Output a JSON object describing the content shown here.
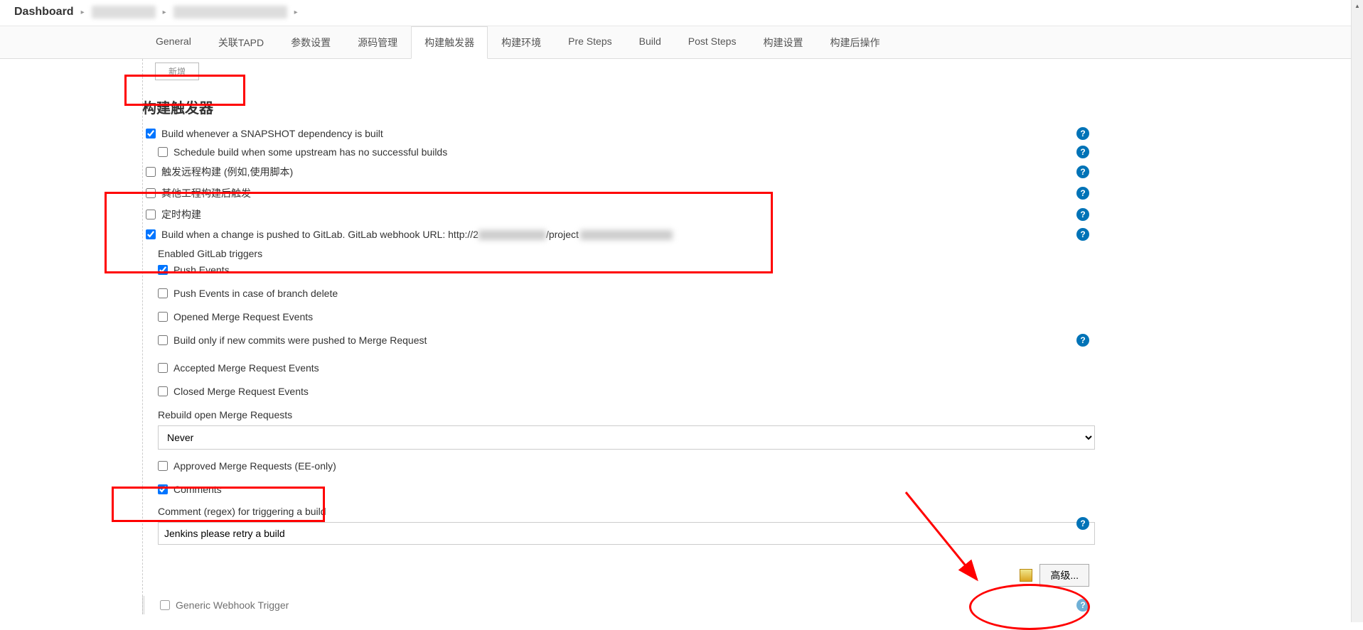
{
  "breadcrumb": {
    "root": "Dashboard"
  },
  "tabs": [
    {
      "label": "General"
    },
    {
      "label": "关联TAPD"
    },
    {
      "label": "参数设置"
    },
    {
      "label": "源码管理"
    },
    {
      "label": "构建触发器",
      "active": true
    },
    {
      "label": "构建环境"
    },
    {
      "label": "Pre Steps"
    },
    {
      "label": "Build"
    },
    {
      "label": "Post Steps"
    },
    {
      "label": "构建设置"
    },
    {
      "label": "构建后操作"
    }
  ],
  "top_button": "新增",
  "section_title": "构建触发器",
  "triggers": {
    "snapshot": {
      "label": "Build whenever a SNAPSHOT dependency is built",
      "checked": true,
      "help": true
    },
    "schedule_upstream": {
      "label": "Schedule build when some upstream has no successful builds",
      "checked": false,
      "help": true
    },
    "remote": {
      "label": "触发远程构建 (例如,使用脚本)",
      "checked": false,
      "help": true
    },
    "other_project": {
      "label": "其他工程构建后触发",
      "checked": false,
      "help": true
    },
    "periodic": {
      "label": "定时构建",
      "checked": false,
      "help": true
    },
    "gitlab": {
      "label_prefix": "Build when a change is pushed to GitLab. GitLab webhook URL: http://2",
      "label_suffix": "/project",
      "checked": true,
      "help": true
    },
    "gitlab_enabled": "Enabled GitLab triggers",
    "gitlab_options": {
      "push_events": {
        "label": "Push Events",
        "checked": true
      },
      "push_delete": {
        "label": "Push Events in case of branch delete",
        "checked": false
      },
      "opened_mr": {
        "label": "Opened Merge Request Events",
        "checked": false
      },
      "new_commits_mr": {
        "label": "Build only if new commits were pushed to Merge Request",
        "checked": false,
        "help": true
      },
      "accepted_mr": {
        "label": "Accepted Merge Request Events",
        "checked": false
      },
      "closed_mr": {
        "label": "Closed Merge Request Events",
        "checked": false
      }
    },
    "rebuild_mr_label": "Rebuild open Merge Requests",
    "rebuild_mr_value": "Never",
    "approved_mr": {
      "label": "Approved Merge Requests (EE-only)",
      "checked": false
    },
    "comments": {
      "label": "Comments",
      "checked": true
    },
    "comment_regex_label": "Comment (regex) for triggering a build",
    "comment_regex_value": "Jenkins please retry a build",
    "comment_regex_help": true,
    "advanced_btn": "高级...",
    "generic_webhook": {
      "label": "Generic Webhook Trigger",
      "checked": false
    }
  }
}
